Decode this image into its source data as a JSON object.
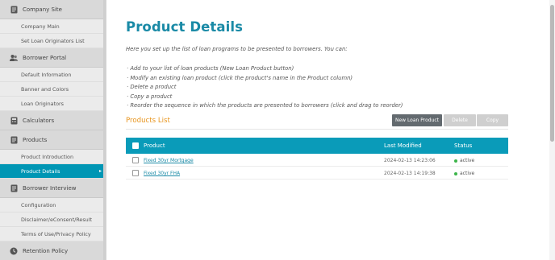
{
  "sidebar": {
    "sections": [
      {
        "icon": "document-icon",
        "label": "Company Site",
        "items": [
          {
            "label": "Company Main"
          },
          {
            "label": "Set Loan Originators List"
          }
        ]
      },
      {
        "icon": "users-icon",
        "label": "Borrower Portal",
        "items": [
          {
            "label": "Default Information"
          },
          {
            "label": "Banner and Colors"
          },
          {
            "label": "Loan Originators"
          }
        ]
      },
      {
        "icon": "calculator-icon",
        "label": "Calculators",
        "items": []
      },
      {
        "icon": "document-icon",
        "label": "Products",
        "items": [
          {
            "label": "Product Introduction"
          },
          {
            "label": "Product Details",
            "active": true
          }
        ]
      },
      {
        "icon": "document-icon",
        "label": "Borrower Interview",
        "items": [
          {
            "label": "Configuration"
          },
          {
            "label": "Disclaimer/eConsent/Result"
          },
          {
            "label": "Terms of Use/Privacy Policy"
          }
        ]
      },
      {
        "icon": "clock-icon",
        "label": "Retention Policy",
        "items": []
      }
    ]
  },
  "main": {
    "title": "Product Details",
    "intro": "Here you set up the list of loan programs to be presented to borrowers. You can:",
    "bullets": [
      "· Add to your list of loan products (New Loan Product button)",
      "· Modify an existing loan product (click the product's name in the Product column)",
      "· Delete a product",
      "· Copy a product",
      "· Reorder the sequence in which the products are presented to borrowers (click and drag to reorder)"
    ],
    "list_title": "Products List",
    "buttons": {
      "new": "New Loan Product",
      "delete": "Delete",
      "copy": "Copy"
    },
    "table": {
      "headers": {
        "product": "Product",
        "last_modified": "Last Modified",
        "status": "Status"
      },
      "rows": [
        {
          "product": "Fixed 30yr Mortgage",
          "last_modified": "2024-02-13 14:23:06",
          "status": "active"
        },
        {
          "product": "Fixed 30yr FHA",
          "last_modified": "2024-02-13 14:19:38",
          "status": "active"
        }
      ]
    }
  },
  "colors": {
    "accent": "#0a9bb9",
    "title": "#1a8aa6",
    "list_title": "#e8951e",
    "status_active": "#3cb54a"
  }
}
